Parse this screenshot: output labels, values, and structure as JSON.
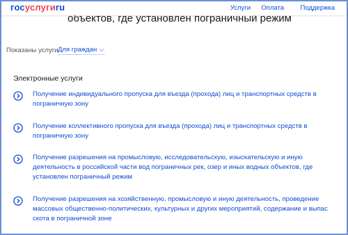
{
  "header": {
    "logo": {
      "part1": "гос",
      "part2": "услуги",
      "part3": "ru"
    },
    "nav": [
      {
        "label": "Услуги"
      },
      {
        "label": "Оплата"
      },
      {
        "label": "Поддержка"
      }
    ]
  },
  "page_title": "объектов, где установлен пограничный режим",
  "filter": {
    "label": "Показаны услуги",
    "value": "Для граждан"
  },
  "section_title": "Электронные услуги",
  "services": [
    {
      "label": "Получение индивидуального пропуска для въезда (прохода) лиц и транспортных средств в пограничную зону"
    },
    {
      "label": "Получение коллективного пропуска для въезда (прохода) лиц и транспортных средств в пограничную зону"
    },
    {
      "label": "Получение разрешения на промысловую, исследовательскую, изыскательскую и иную деятельность в российской части вод пограничных рек, озер и иных водных объектов, где установлен пограничный режим"
    },
    {
      "label": "Получение разрешения на хозяйственную, промысловую и иную деятельность, проведение массовых общественно-политических, культурных и других мероприятий, содержание и выпас скота в пограничной зоне"
    }
  ],
  "colors": {
    "link": "#0d4cd3",
    "brand_red": "#ee3f58",
    "frame": "#6b8fd1"
  },
  "icons": {
    "service_arrow": "chevron-right-circle-icon",
    "filter_arrow": "chevron-down-icon"
  }
}
